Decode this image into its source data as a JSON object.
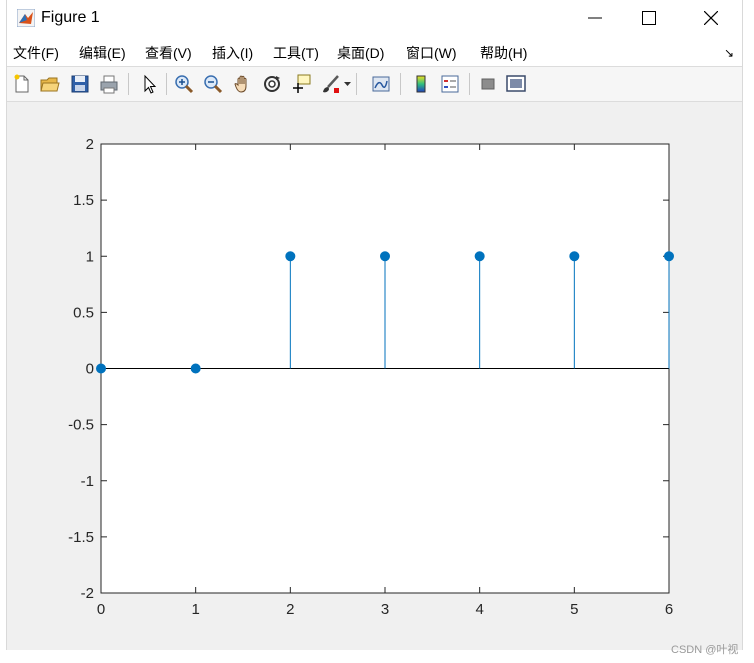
{
  "window": {
    "title": "Figure 1",
    "controls": {
      "minimize": "minimize-icon",
      "maximize": "maximize-icon",
      "close": "close-icon"
    }
  },
  "menubar": {
    "items": [
      "文件(F)",
      "编辑(E)",
      "查看(V)",
      "插入(I)",
      "工具(T)",
      "桌面(D)",
      "窗口(W)",
      "帮助(H)"
    ],
    "overflow_arrow": "↘"
  },
  "toolbar": {
    "icons": [
      "new-figure-icon",
      "open-file-icon",
      "save-icon",
      "print-icon",
      "select-arrow-icon",
      "zoom-in-icon",
      "zoom-out-icon",
      "pan-hand-icon",
      "rotate-3d-icon",
      "data-cursor-icon",
      "brush-icon",
      "link-plot-icon",
      "colorbar-icon",
      "legend-icon",
      "hide-plot-tools-icon",
      "show-plot-tools-icon"
    ]
  },
  "chart_data": {
    "type": "stem",
    "x": [
      0,
      1,
      2,
      3,
      4,
      5,
      6
    ],
    "y": [
      0,
      0,
      1,
      1,
      1,
      1,
      1
    ],
    "xlim": [
      0,
      6
    ],
    "ylim": [
      -2,
      2
    ],
    "xticks": [
      "0",
      "1",
      "2",
      "3",
      "4",
      "5",
      "6"
    ],
    "yticks": [
      "2",
      "1.5",
      "1",
      "0.5",
      "0",
      "-0.5",
      "-1",
      "-1.5",
      "-2"
    ],
    "title": "",
    "xlabel": "",
    "ylabel": "",
    "grid": false,
    "colors": {
      "series": "#0072bd",
      "baseline": "#000000",
      "axes": "#262626"
    }
  },
  "watermark": "CSDN @叶视"
}
